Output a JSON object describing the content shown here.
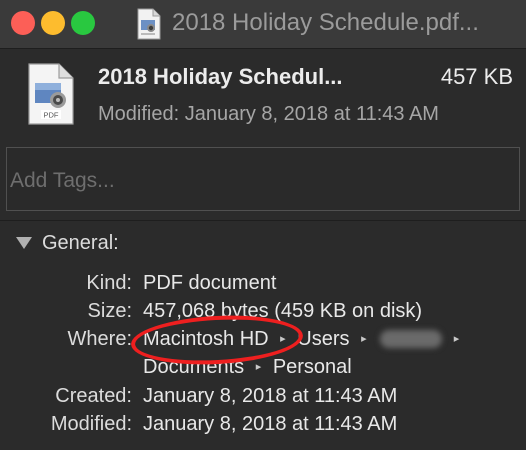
{
  "window": {
    "title": "2018 Holiday Schedule.pdf..."
  },
  "header": {
    "name": "2018 Holiday Schedul...",
    "size": "457 KB",
    "modified": "Modified: January 8, 2018 at 11:43 AM",
    "icon_badge": "PDF"
  },
  "tags": {
    "placeholder": "Add Tags...",
    "value": ""
  },
  "general": {
    "label": "General:",
    "expanded": true,
    "kind_label": "Kind:",
    "kind_value": "PDF document",
    "size_label": "Size:",
    "size_value": "457,068 bytes (459 KB on disk)",
    "where_label": "Where:",
    "where_path": {
      "segment1": "Macintosh HD",
      "segment2": "Users",
      "segment4": "Documents",
      "segment5": "Personal"
    },
    "created_label": "Created:",
    "created_value": "January 8, 2018 at 11:43 AM",
    "modified_label": "Modified:",
    "modified_value": "January 8, 2018 at 11:43 AM"
  },
  "colors": {
    "close": "#fc5f57",
    "minimize": "#fdbc2e",
    "zoom": "#29c840",
    "annotation": "#ee1f1f"
  },
  "icons": {
    "title_icon": "pdf-document-icon",
    "header_icon": "pdf-document-icon",
    "disclosure": "disclosure-triangle-down-icon",
    "path_separator": "path-separator-triangle-icon"
  }
}
